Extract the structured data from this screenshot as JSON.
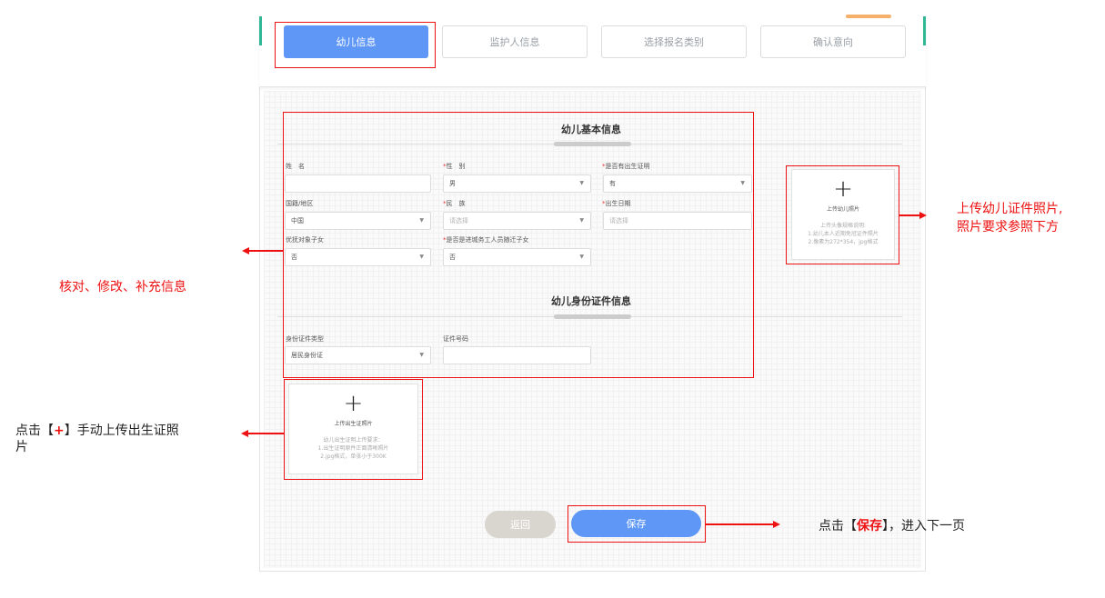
{
  "tabs": [
    {
      "label": "幼儿信息",
      "active": true
    },
    {
      "label": "监护人信息",
      "active": false
    },
    {
      "label": "选择报名类别",
      "active": false
    },
    {
      "label": "确认意向"
    }
  ],
  "section1": {
    "title": "幼儿基本信息",
    "fields": {
      "name": {
        "label": "姓　名",
        "required": false,
        "value": ""
      },
      "gender": {
        "label": "性　别",
        "required": true,
        "value": "男"
      },
      "birthcert": {
        "label": "是否有出生证明",
        "required": true,
        "value": "有"
      },
      "region": {
        "label": "国籍/地区",
        "required": false,
        "value": "中国"
      },
      "ethnic": {
        "label": "民　族",
        "required": true,
        "value": "请选择"
      },
      "birthdate": {
        "label": "出生日期",
        "required": true,
        "placeholder": "请选择"
      },
      "priority": {
        "label": "优抚对象子女",
        "required": false,
        "value": "否"
      },
      "migrant": {
        "label": "是否是进城务工人员随迁子女",
        "required": true,
        "value": "否"
      }
    }
  },
  "section2": {
    "title": "幼儿身份证件信息",
    "fields": {
      "idtype": {
        "label": "身份证件类型",
        "value": "居民身份证"
      },
      "idno": {
        "label": "证件号码",
        "value": ""
      }
    }
  },
  "upload_photo": {
    "title": "上传幼儿照片",
    "req": [
      "上传头像规格说明:",
      "1.幼儿本人近期免冠证件照片",
      "2.像素为272*354，jpg格式"
    ]
  },
  "upload_cert": {
    "title": "上传出生证照片",
    "req": [
      "幼儿出生证明上传要求：",
      "1.出生证明原件正面清晰照片",
      "2.jpg格式，单张小于300K"
    ]
  },
  "buttons": {
    "back": "返回",
    "save": "保存"
  },
  "notes": {
    "verify": "核对、修改、补充信息",
    "photo_line1": "上传幼儿证件照片,",
    "photo_line2": "照片要求参照下方",
    "upload_pre": "点击【",
    "upload_plus": "+",
    "upload_post": "】手动上传出生证照",
    "upload_line2": "片",
    "save_pre": "点击【",
    "save_word": "保存",
    "save_post": "】，进入下一页"
  },
  "colors": {
    "accent": "#5e97f6",
    "annotation": "#e11111",
    "teal": "#2fb796"
  }
}
